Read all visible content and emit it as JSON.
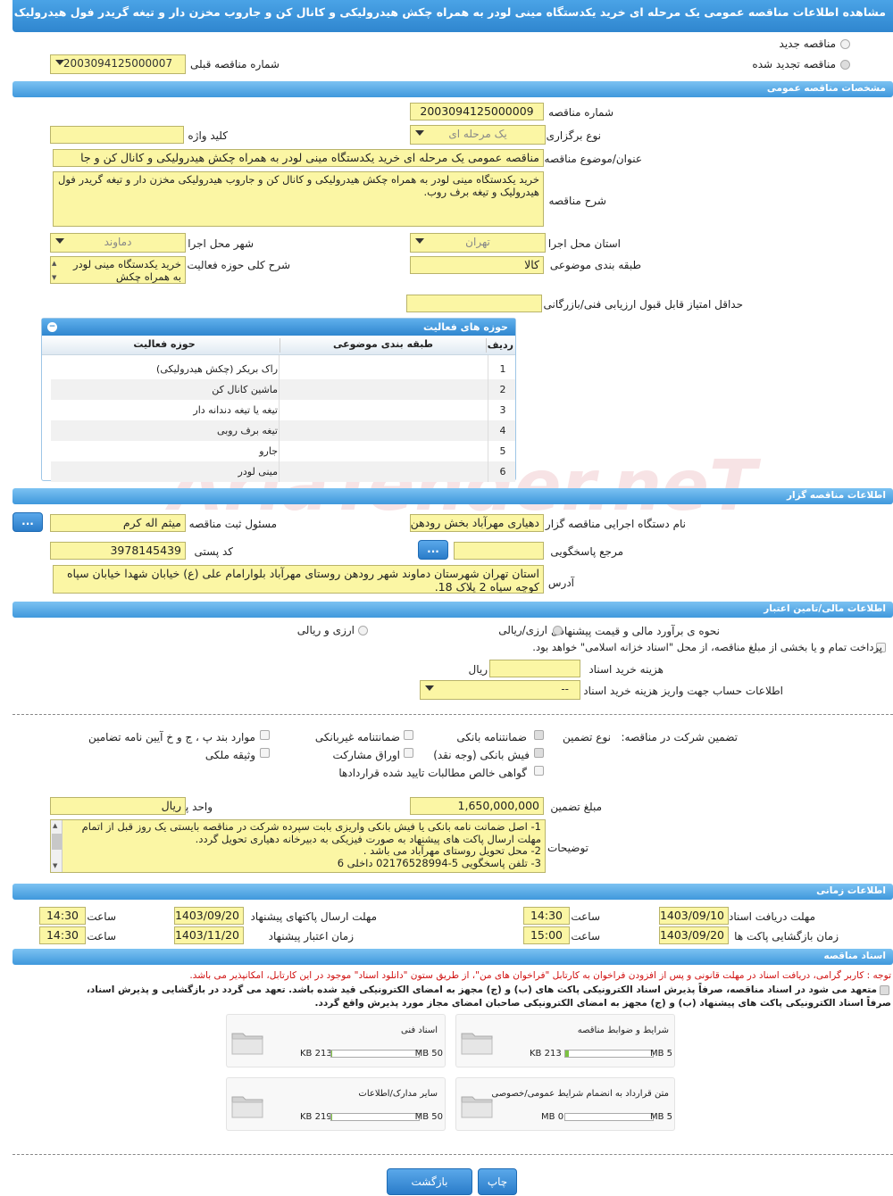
{
  "header": {
    "title": "مشاهده اطلاعات مناقصه عمومی یک مرحله ای خرید یکدستگاه مینی لودر به همراه چکش هیدرولیکی و کانال کن و جاروب مخزن دار و تیغه گریدر فول هیدرولیک و تیغه برف روب."
  },
  "tender_type": {
    "new_label": "مناقصه جدید",
    "renewed_label": "مناقصه تجدید شده",
    "prev_number_label": "شماره مناقصه قبلی",
    "prev_number_value": "2003094125000007"
  },
  "sections": {
    "general": "مشخصات مناقصه عمومی",
    "organizer": "اطلاعات مناقصه گزار",
    "finance": "اطلاعات مالی/تامین اعتبار",
    "timing": "اطلاعات زمانی",
    "docs": "اسناد مناقصه"
  },
  "general": {
    "number_label": "شماره مناقصه",
    "number_value": "2003094125000009",
    "keyword_label": "کلید واژه",
    "keyword_value": "",
    "holding_type_label": "نوع برگزاری",
    "holding_type_value": "یک مرحله ای",
    "subject_label": "عنوان/موضوع مناقصه",
    "subject_value": "مناقصه عمومی یک مرحله ای خرید یکدستگاه مینی لودر به همراه چکش هیدرولیکی و کانال کن و جا",
    "desc_label": "شرح مناقصه",
    "desc_value": "خرید یکدستگاه مینی لودر به همراه چکش هیدرولیکی و کانال کن و جاروب هیدرولیکی مخزن دار و تیغه گریدر فول هیدرولیک و تیغه برف روب.",
    "province_label": "استان محل اجرا",
    "province_value": "تهران",
    "city_label": "شهر محل اجرا",
    "city_value": "دماوند",
    "category_label": "طبقه بندی موضوعی",
    "category_value": "کالا",
    "scope_label": "شرح کلی حوزه فعالیت",
    "scope_value": "خرید یکدستگاه مینی لودر به همراه چکش",
    "min_score_label": "حداقل امتیاز قابل قبول ارزیابی فنی/بازرگانی",
    "min_score_value": ""
  },
  "activity_grid": {
    "title": "حوزه های فعالیت",
    "columns": {
      "row": "ردیف",
      "category": "طبقه بندی موضوعی",
      "activity": "حوزه فعالیت"
    },
    "rows": [
      {
        "n": "1",
        "category": "",
        "activity": "راک بریکر (چکش هیدرولیکی)"
      },
      {
        "n": "2",
        "category": "",
        "activity": "ماشین کانال کن"
      },
      {
        "n": "3",
        "category": "",
        "activity": "تیغه یا تیغه دندانه دار"
      },
      {
        "n": "4",
        "category": "",
        "activity": "تیغه برف روبی"
      },
      {
        "n": "5",
        "category": "",
        "activity": "جارو"
      },
      {
        "n": "6",
        "category": "",
        "activity": "مینی لودر"
      }
    ]
  },
  "organizer": {
    "org_label": "نام دستگاه اجرایی مناقصه گزار",
    "org_value": "دهیاری مهرآباد بخش رودهن",
    "officer_label": "مسئول ثبت مناقصه",
    "officer_value": "میثم اله کرم",
    "ref_label": "مرجع پاسخگویی",
    "ref_value": "",
    "postal_label": "کد پستی",
    "postal_value": "3978145439",
    "address_label": "آدرس",
    "address_value": "استان تهران شهرستان دماوند شهر رودهن روستای مهرآباد بلوارامام علی (ع) خیابان شهدا خیابان سپاه کوچه سپاه 2 پلاک 18.",
    "more_btn": "..."
  },
  "finance": {
    "method_label": "نحوه ی برآورد مالی و قیمت پیشنهادی",
    "opt_rial": "ارزی/ریالی",
    "opt_currency": "ارزی و ریالی",
    "treasury_text": "پرداخت تمام و یا بخشی از مبلغ مناقصه، از محل \"اسناد خزانه اسلامی\" خواهد بود.",
    "doc_fee_label": "هزینه خرید اسناد",
    "doc_fee_value": "",
    "doc_fee_unit": "ریال",
    "account_label": "اطلاعات حساب جهت واریز هزینه خرید اسناد",
    "account_value": "--",
    "guarantee_label": "تضمین شرکت در مناقصه:",
    "guarantee_type_label": "نوع تضمین",
    "g_bank": "ضمانتنامه بانکی",
    "g_nonbank": "ضمانتنامه غیربانکی",
    "g_clauses": "موارد بند پ ، ج و خ آیین نامه تضامین",
    "g_cash": "فیش بانکی (وجه نقد)",
    "g_bonds": "اوراق مشارکت",
    "g_property": "وثیقه ملکی",
    "g_claims": "گواهی خالص مطالبات تایید شده قراردادها",
    "amount_label": "مبلغ تضمین",
    "amount_value": "1,650,000,000",
    "currency_label": "واحد پول",
    "currency_value": "ریال",
    "notes_label": "توضیحات",
    "notes_lines": [
      "1- اصل ضمانت نامه بانکی یا فیش بانکی واریزی بابت سپرده شرکت در مناقصه بایستی یک روز قبل از اتمام",
      "مهلت ارسال پاکت های پیشنهاد به صورت فیزیکی به دبیرخانه دهیاری تحویل گردد.",
      "2- محل تحویل روستای مهرآباد می باشد .",
      "3- تلفن پاسخگویی 5-02176528994 داخلی 6"
    ]
  },
  "timing": {
    "recv_deadline_label": "مهلت دریافت اسناد",
    "recv_date": "1403/09/10",
    "recv_time": "14:30",
    "send_deadline_label": "مهلت ارسال پاکتهای پیشنهاد",
    "send_date": "1403/09/20",
    "send_time": "14:30",
    "open_label": "زمان بازگشایی پاکت ها",
    "open_date": "1403/09/20",
    "open_time": "15:00",
    "validity_label": "زمان اعتبار پیشنهاد",
    "validity_date": "1403/11/20",
    "validity_time": "14:30",
    "time_label": "ساعت"
  },
  "docs": {
    "notice": "توجه : کاربر گرامی، دریافت اسناد در مهلت قانونی و پس از افزودن فراخوان به کارتابل \"فراخوان های من\"، از طریق ستون \"دانلود اسناد\" موجود در این کارتابل، امکانپذیر می باشد.",
    "commit_line1": "متعهد می شود در اسناد مناقصه، صرفاً پذیرش اسناد الکترونیکی پاکت های (ب) و (ج) مجهز به امضای الکترونیکی قید شده باشد. تعهد می گردد در بازگشایی و پذیرش اسناد،",
    "commit_line2": "صرفاً اسناد الکترونیکی پاکت های پیشنهاد (ب) و (ج) مجهز به امضای الکترونیکی صاحبان امضای مجاز مورد پذیرش واقع گردد.",
    "files": [
      {
        "name": "شرایط و ضوابط مناقصه",
        "size": "213 KB",
        "max": "5 MB",
        "fill": 0.04
      },
      {
        "name": "اسناد فنی",
        "size": "213 KB",
        "max": "50 MB",
        "fill": 0.004
      },
      {
        "name": "متن قرارداد به انضمام شرایط عمومی/خصوصی",
        "size": "0 MB",
        "max": "5 MB",
        "fill": 0
      },
      {
        "name": "سایر مدارک/اطلاعات",
        "size": "219 KB",
        "max": "50 MB",
        "fill": 0.004
      }
    ]
  },
  "actions": {
    "print": "چاپ",
    "back": "بازگشت"
  },
  "watermark": "AriaTender.neT",
  "colors": {
    "accent": "#2f86cf",
    "field": "#fbf6a4",
    "notice": "#d01010"
  }
}
